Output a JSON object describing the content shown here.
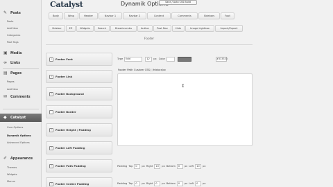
{
  "sidebar": {
    "items": [
      {
        "label": "Posts",
        "icon": "pin-icon"
      },
      {
        "label": "Media",
        "icon": "media-icon"
      },
      {
        "label": "Links",
        "icon": "link-icon"
      },
      {
        "label": "Pages",
        "icon": "page-icon"
      },
      {
        "label": "Comments",
        "icon": "comment-icon"
      },
      {
        "label": "Catalyst",
        "icon": "catalyst-icon"
      },
      {
        "label": "Appearance",
        "icon": "brush-icon"
      }
    ],
    "posts_sub": [
      "Posts",
      "Add New",
      "Categories",
      "Post Tags"
    ],
    "pages_sub": [
      "Pages",
      "Add New"
    ],
    "catalyst_sub": [
      "Core Options",
      "Dynamik Options",
      "Advanced Options"
    ],
    "appearance_sub": [
      "Themes",
      "Widgets",
      "Menus"
    ]
  },
  "banner": {
    "logo": "Catalyst",
    "subtitle": "Dynamik Options",
    "button": "Save / Auto CSS Build"
  },
  "tabs_row1": [
    "Body",
    "Wrap",
    "Header",
    "Navbar 1",
    "Navbar 2",
    "Content",
    "Comments",
    "Sidebars",
    "Foot"
  ],
  "tabs_row2": [
    "Sidebar",
    "EZ",
    "Widgets",
    "Search",
    "Breadcrumbs",
    "Author",
    "Post Nav",
    "Hide",
    "Image Lightbox",
    "Import/Export"
  ],
  "section_title": "Footer",
  "options": [
    {
      "label": "Footer Font",
      "icon": "check-box-icon",
      "checked": true
    },
    {
      "label": "Footer Link",
      "icon": "check-box-icon",
      "checked": true
    },
    {
      "label": "Footer Background",
      "icon": "check-box-icon",
      "checked": true
    },
    {
      "label": "Footer Border",
      "icon": "check-box-icon",
      "checked": false
    },
    {
      "label": "Footer Height / Padding",
      "icon": "check-box-icon",
      "checked": true
    },
    {
      "label": "Footer Left Padding",
      "icon": "check-box-icon",
      "checked": true
    },
    {
      "label": "Footer Path Padding",
      "icon": "check-box-icon",
      "checked": true
    },
    {
      "label": "Footer Center Padding",
      "icon": "check-box-icon",
      "checked": true
    }
  ],
  "font_row": {
    "type_label": "Type",
    "type_value": "Ibid",
    "size_value": "12",
    "size_unit": "px",
    "color_label": "Color",
    "color_hex": "#333333",
    "swatch_color": "#777777"
  },
  "editor_label": "Footer Path Custom CSS | /htdocs/xc",
  "editor_caret": "I",
  "padding_row1": {
    "label": "Padding",
    "top_label": "Top",
    "top": "0",
    "right_label": "Right",
    "right": "10",
    "bottom_label": "Bottom",
    "bottom": "0",
    "left_label": "Left",
    "left": "10",
    "unit": "px"
  },
  "padding_row2": {
    "label": "Padding",
    "top_label": "Top",
    "top": "0",
    "right_label": "Right",
    "right": "0",
    "bottom_label": "Bottom",
    "bottom": "0",
    "left_label": "Left",
    "left": "0",
    "unit": "px"
  }
}
